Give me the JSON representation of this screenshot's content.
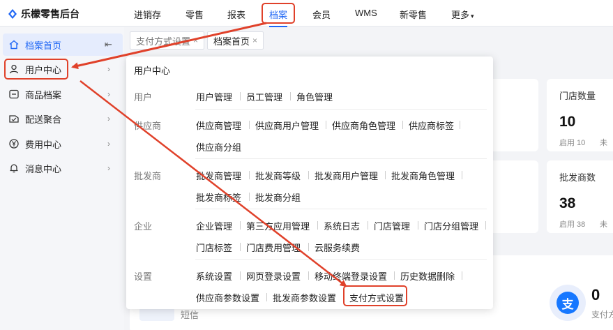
{
  "app": {
    "title": "乐檬零售后台"
  },
  "topnav": [
    "进销存",
    "零售",
    "报表",
    "档案",
    "会员",
    "WMS",
    "新零售",
    "更多"
  ],
  "topnav_active": "档案",
  "topnav_more_suffix": "▾",
  "sidebar": {
    "items": [
      {
        "label": "档案首页",
        "icon": "home-icon"
      },
      {
        "label": "用户中心",
        "icon": "user-icon"
      },
      {
        "label": "商品档案",
        "icon": "goods-icon"
      },
      {
        "label": "配送聚合",
        "icon": "delivery-icon"
      },
      {
        "label": "费用中心",
        "icon": "yen-icon"
      },
      {
        "label": "消息中心",
        "icon": "bell-icon"
      }
    ],
    "collapse_glyph": "⇤"
  },
  "tabs": [
    {
      "label": "支付方式设置",
      "close": "×"
    },
    {
      "label": "档案首页",
      "close": "×"
    }
  ],
  "cards": [
    {
      "title": "门店数量",
      "value": "10",
      "sub": "启用 10",
      "sub2": "未"
    },
    {
      "title": "批发商数",
      "value": "38",
      "sub": "启用 38",
      "sub2": "未"
    }
  ],
  "bottom": {
    "sms_label": "短信",
    "pay_count": "0",
    "pay_label": "支付方"
  },
  "panel": {
    "title": "用户中心",
    "groups": [
      {
        "category": "用户",
        "links": [
          "用户管理",
          "员工管理",
          "角色管理"
        ]
      },
      {
        "category": "供应商",
        "links": [
          "供应商管理",
          "供应商用户管理",
          "供应商角色管理",
          "供应商标签",
          "供应商分组"
        ]
      },
      {
        "category": "批发商",
        "links": [
          "批发商管理",
          "批发商等级",
          "批发商用户管理",
          "批发商角色管理",
          "批发商标签",
          "批发商分组"
        ]
      },
      {
        "category": "企业",
        "links": [
          "企业管理",
          "第三方应用管理",
          "系统日志",
          "门店管理",
          "门店分组管理",
          "门店标签",
          "门店费用管理",
          "云服务续费"
        ]
      },
      {
        "category": "设置",
        "links": [
          "系统设置",
          "网页登录设置",
          "移动终端登录设置",
          "历史数据删除",
          "供应商参数设置",
          "批发商参数设置",
          "支付方式设置"
        ]
      }
    ]
  },
  "colors": {
    "accent": "#1e66f5",
    "highlight": "#e0412a"
  }
}
